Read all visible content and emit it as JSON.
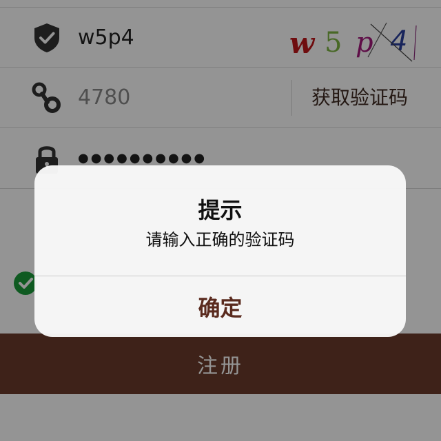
{
  "form": {
    "captcha_field": {
      "value": "w5p4",
      "icon": "shield-check-icon"
    },
    "captcha_image": {
      "chars": [
        "w",
        "5",
        "p",
        "4"
      ],
      "colors": [
        "#c0171b",
        "#7cb342",
        "#a2187a",
        "#2a3f9e"
      ]
    },
    "sms_field": {
      "value": "4780",
      "icon": "key-icon"
    },
    "sms_button_label": "获取验证码",
    "password_field": {
      "masked_value": "●●●●●●●●●●",
      "icon": "lock-icon"
    },
    "agree_checkbox": {
      "checked": true
    }
  },
  "register_button_label": "注册",
  "alert": {
    "title": "提示",
    "message": "请输入正确的验证码",
    "confirm_label": "确定"
  },
  "colors": {
    "accent_brown": "#6b3c2b",
    "check_green": "#1a9c3a"
  }
}
